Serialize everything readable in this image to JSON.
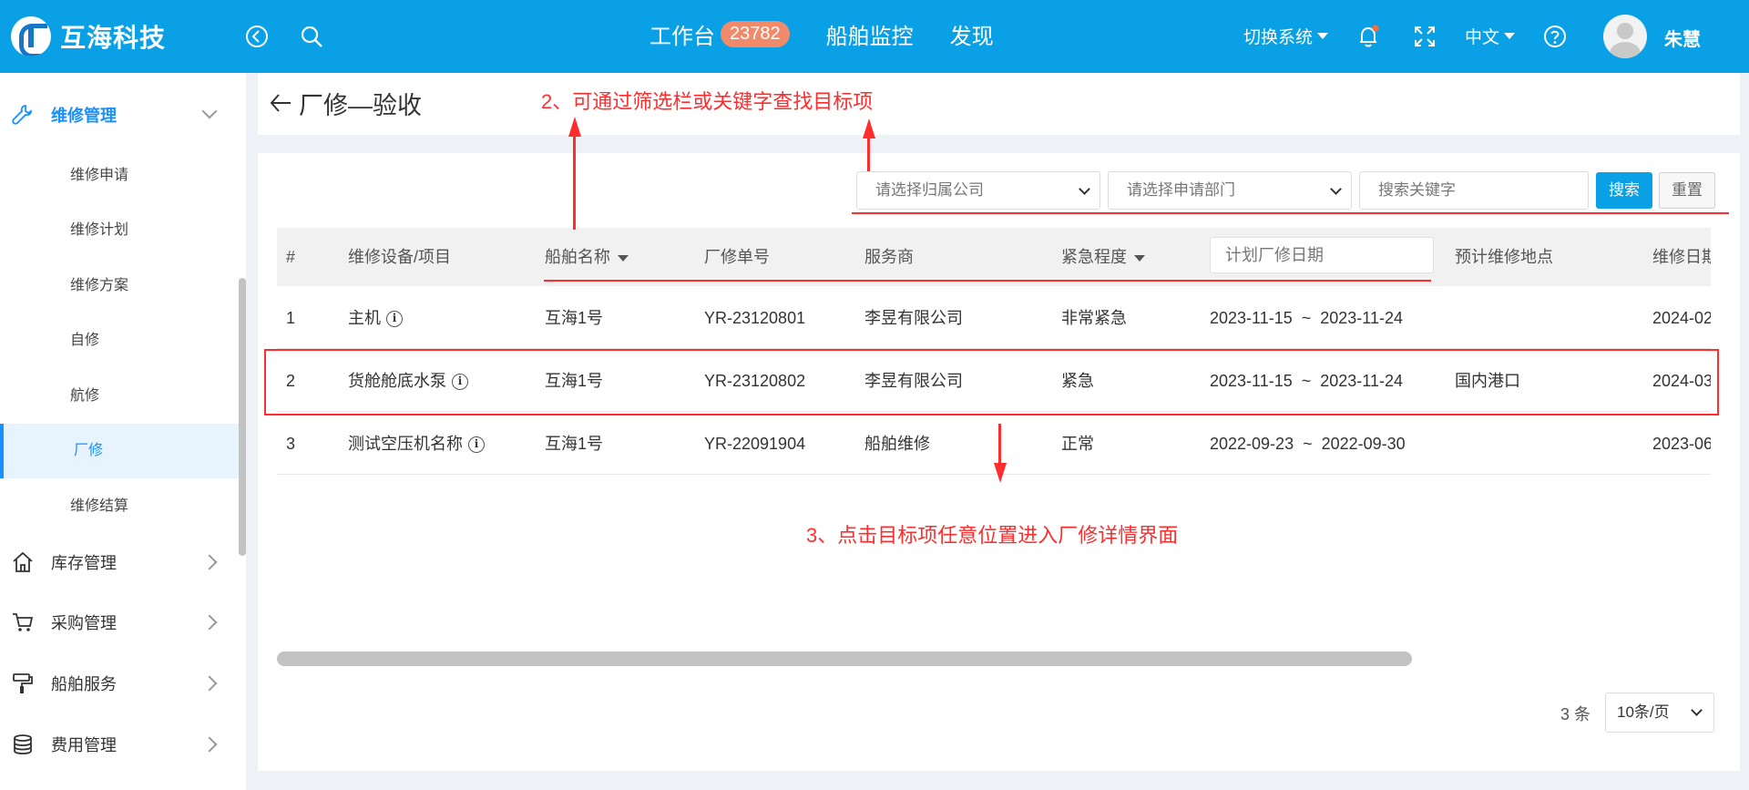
{
  "header": {
    "brand": "互海科技",
    "nav": [
      {
        "label": "工作台",
        "badge": "23782"
      },
      {
        "label": "船舶监控"
      },
      {
        "label": "发现"
      }
    ],
    "switch_system": "切换系统",
    "language": "中文",
    "username": "朱慧",
    "colors": {
      "header_bg": "#0aa0e6",
      "badge_bg": "#f08a6a",
      "notify_dot": "#ff6a3d"
    }
  },
  "sidebar": {
    "groups": [
      {
        "label": "维修管理",
        "icon": "wrench-icon",
        "expanded": true
      },
      {
        "label": "库存管理",
        "icon": "home-icon"
      },
      {
        "label": "采购管理",
        "icon": "cart-icon"
      },
      {
        "label": "船舶服务",
        "icon": "paint-roller-icon"
      },
      {
        "label": "费用管理",
        "icon": "coins-icon"
      }
    ],
    "sub_items": [
      "维修申请",
      "维修计划",
      "维修方案",
      "自修",
      "航修",
      "厂修",
      "维修结算"
    ],
    "active_sub": "厂修"
  },
  "page": {
    "title": "厂修—验收"
  },
  "filters": {
    "company_placeholder": "请选择归属公司",
    "department_placeholder": "请选择申请部门",
    "keyword_placeholder": "搜索关键字",
    "search_label": "搜索",
    "reset_label": "重置"
  },
  "table": {
    "columns": {
      "index": "#",
      "item": "维修设备/项目",
      "ship": "船舶名称",
      "order_no": "厂修单号",
      "vendor": "服务商",
      "urgency": "紧急程度",
      "plan_date_placeholder": "计划厂修日期",
      "location": "预计维修地点",
      "repair_date": "维修日期"
    },
    "rows": [
      {
        "index": "1",
        "item": "主机",
        "ship": "互海1号",
        "order_no": "YR-23120801",
        "vendor": "李昱有限公司",
        "urgency": "非常紧急",
        "plan_date": "2023-11-15  ~  2023-11-24",
        "location": "",
        "repair_date": "2024-02"
      },
      {
        "index": "2",
        "item": "货舱舱底水泵",
        "ship": "互海1号",
        "order_no": "YR-23120802",
        "vendor": "李昱有限公司",
        "urgency": "紧急",
        "plan_date": "2023-11-15  ~  2023-11-24",
        "location": "国内港口",
        "repair_date": "2024-03"
      },
      {
        "index": "3",
        "item": "测试空压机名称",
        "ship": "互海1号",
        "order_no": "YR-22091904",
        "vendor": "船舶维修",
        "urgency": "正常",
        "plan_date": "2022-09-23  ~  2022-09-30",
        "location": "",
        "repair_date": "2023-06"
      }
    ]
  },
  "pagination": {
    "total": "3 条",
    "page_size": "10条/页"
  },
  "annotations": {
    "filter_hint": "2、可通过筛选栏或关键字查找目标项",
    "click_hint": "3、点击目标项任意位置进入厂修详情界面",
    "color": "#ff2d2d"
  }
}
